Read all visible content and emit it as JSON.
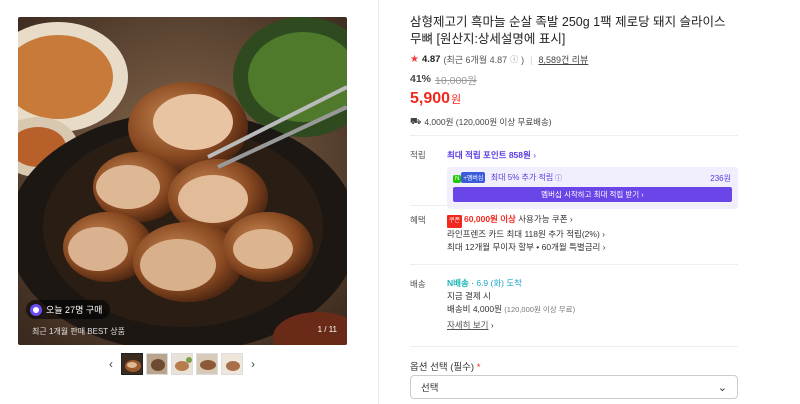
{
  "gallery": {
    "buy_badge": "오늘 27명 구매",
    "best_label": "최근 1개월 판매 BEST 상품",
    "counter": "1 / 11",
    "prev_icon": "chevron-left-icon",
    "next_icon": "chevron-right-icon",
    "thumbnail_count": 5,
    "active_thumbnail": 1
  },
  "product": {
    "title": "삼형제고기 흑마늘 순살 족발 250g 1팩 제로당 돼지 슬라이스 무뼈 [원산지:상세설명에 표시]",
    "rating": "4.87",
    "rating_recent": "(최근 6개월 4.87",
    "rating_recent_close": ")",
    "review_count": "8,589건 리뷰",
    "discount": "41%",
    "original_price": "10,000원",
    "price": "5,900",
    "price_unit": "원",
    "shipping": "4,000원 (120,000원 이상 무료배송)"
  },
  "points": {
    "label": "적립",
    "max_point": "최대 적립 포인트 858원",
    "np_logo": "N",
    "np_logo2": "+멤버십",
    "extra_rate": "최대 5% 추가 적립",
    "extra_amount": "236원",
    "member_button": "멤버십 시작하고 최대 적립 받기"
  },
  "benefits": {
    "label": "혜택",
    "coupon_icon": "쿠폰",
    "coupon_amount": "60,000원 이상",
    "coupon_text": " 사용가능 쿠폰",
    "card_text": "라인프렌즈 카드 최대 118원 추가 적립(2%)",
    "installment_text": "최대 12개월 무이자 할부 • 60개월 특별금리"
  },
  "delivery": {
    "label": "배송",
    "delivery_badge": "N배송",
    "date": "6.9 (화) 도착",
    "payment_note": "지금 결제 시",
    "fee_label": "배송비 4,000원",
    "fee_note": "(120,000원 이상 무료)",
    "detail_link": "자세히 보기"
  },
  "options": {
    "label": "옵션 선택 (필수)",
    "required_mark": "*",
    "select_value": "선택"
  },
  "colors": {
    "price_red": "#f0281e",
    "point_purple": "#5a3ae0",
    "member_button": "#6a46e8"
  }
}
